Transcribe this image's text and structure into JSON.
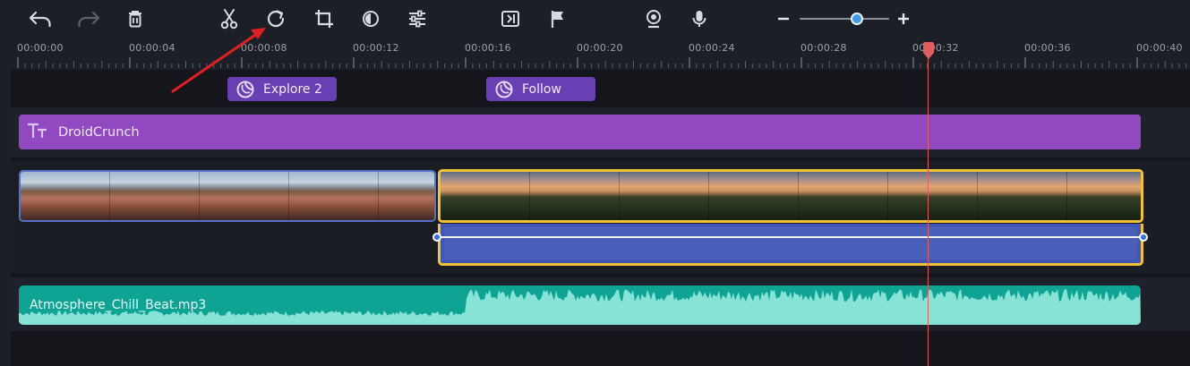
{
  "toolbar": {
    "icons": [
      "undo-icon",
      "redo-icon",
      "delete-icon",
      "cut-icon",
      "rotate-icon",
      "crop-icon",
      "color-adjust-icon",
      "settings-sliders-icon",
      "export-frame-icon",
      "marker-flag-icon",
      "webcam-icon",
      "microphone-icon",
      "zoom-out-icon",
      "zoom-in-icon"
    ]
  },
  "zoom": {
    "level": 0.64
  },
  "ruler": {
    "labels": [
      "00:00:00",
      "00:00:04",
      "00:00:08",
      "00:00:12",
      "00:00:16",
      "00:00:20",
      "00:00:24",
      "00:00:28",
      "00:00:32",
      "00:00:36",
      "00:00:40"
    ]
  },
  "title_clips": [
    {
      "label": "Explore 2",
      "icon": "sticker-icon"
    },
    {
      "label": "Follow",
      "icon": "sticker-icon"
    }
  ],
  "text_track": {
    "label": "DroidCrunch",
    "icon": "text-icon"
  },
  "audio_track": {
    "label": "Atmosphere_Chill_Beat.mp3"
  },
  "playhead": {
    "time": "00:00:32"
  },
  "colors": {
    "accent": "#3d9be9",
    "title_clip": "#6a3fb3",
    "text_track": "#9149c2",
    "selection": "#f1c232",
    "audio": "#0fa393",
    "playhead": "#e25d5d",
    "annotation_arrow": "#e02020"
  }
}
